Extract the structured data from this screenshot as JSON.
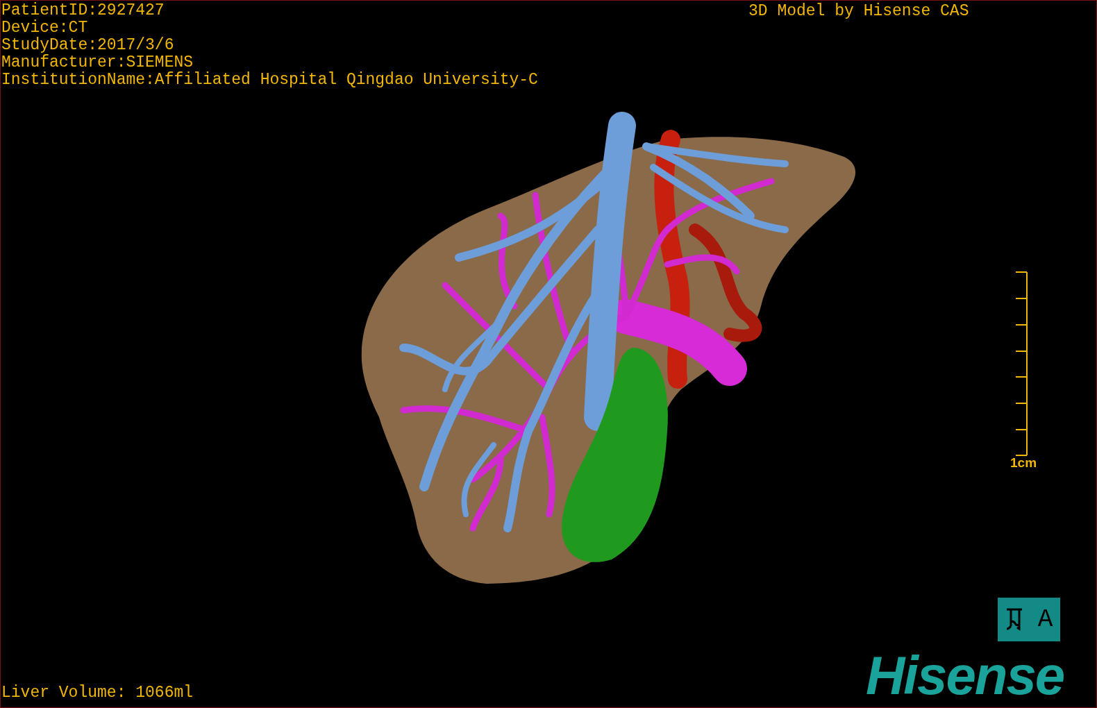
{
  "info_lines": [
    "PatientID:2927427",
    "Device:CT",
    "StudyDate:2017/3/6",
    "Manufacturer:SIEMENS",
    "InstitutionName:Affiliated Hospital Qingdao University-C"
  ],
  "title_right": "3D Model by Hisense CAS",
  "scale_bar": {
    "label": "1cm"
  },
  "orientation_box": {
    "label": "A"
  },
  "volume": "Liver Volume: 1066ml",
  "logo": "Hisense"
}
